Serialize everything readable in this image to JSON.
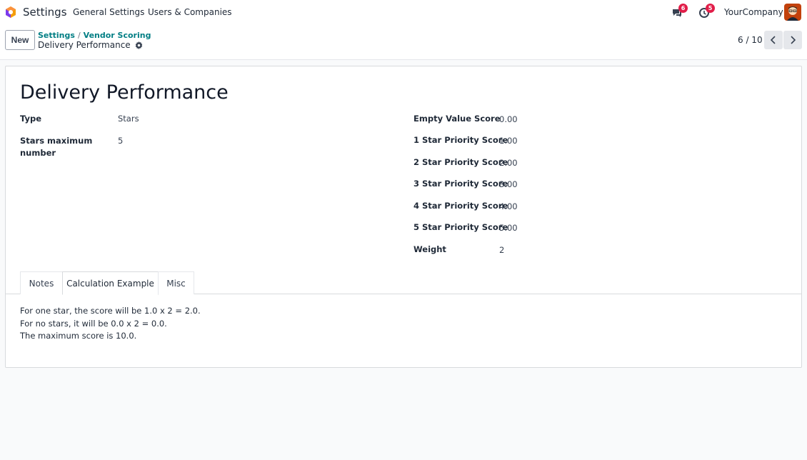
{
  "navbar": {
    "app_name": "Settings",
    "menus": [
      "General Settings",
      "Users & Companies"
    ],
    "messages_count": "6",
    "activities_count": "5",
    "company": "YourCompany"
  },
  "control_panel": {
    "new_label": "New",
    "breadcrumb": [
      "Settings",
      "Vendor Scoring"
    ],
    "record_name": "Delivery Performance",
    "pager": "6 / 10"
  },
  "form": {
    "title": "Delivery Performance",
    "left_fields": [
      {
        "label": "Type",
        "value": "Stars"
      },
      {
        "label": "Stars maximum number",
        "value": "5"
      }
    ],
    "right_fields": [
      {
        "label": "Empty Value Score",
        "value": "0.00"
      },
      {
        "label": "1 Star Priority Score",
        "value": "1.00"
      },
      {
        "label": "2 Star Priority Score",
        "value": "2.00"
      },
      {
        "label": "3 Star Priority Score",
        "value": "3.00"
      },
      {
        "label": "4 Star Priority Score",
        "value": "4.00"
      },
      {
        "label": "5 Star Priority Score",
        "value": "5.00"
      },
      {
        "label": "Weight",
        "value": "2"
      }
    ],
    "tabs": [
      {
        "label": "Notes"
      },
      {
        "label": "Calculation Example"
      },
      {
        "label": "Misc"
      }
    ],
    "active_tab": "Calculation Example",
    "calculation_lines": [
      "For one star, the score will be 1.0 x 2 = 2.0.",
      "For no stars, it will be 0.0 x 2 = 0.0.",
      "The maximum score is 10.0."
    ]
  },
  "colors": {
    "accent": "#017e84",
    "brand": "#714b67",
    "badge": "#e11d48"
  }
}
